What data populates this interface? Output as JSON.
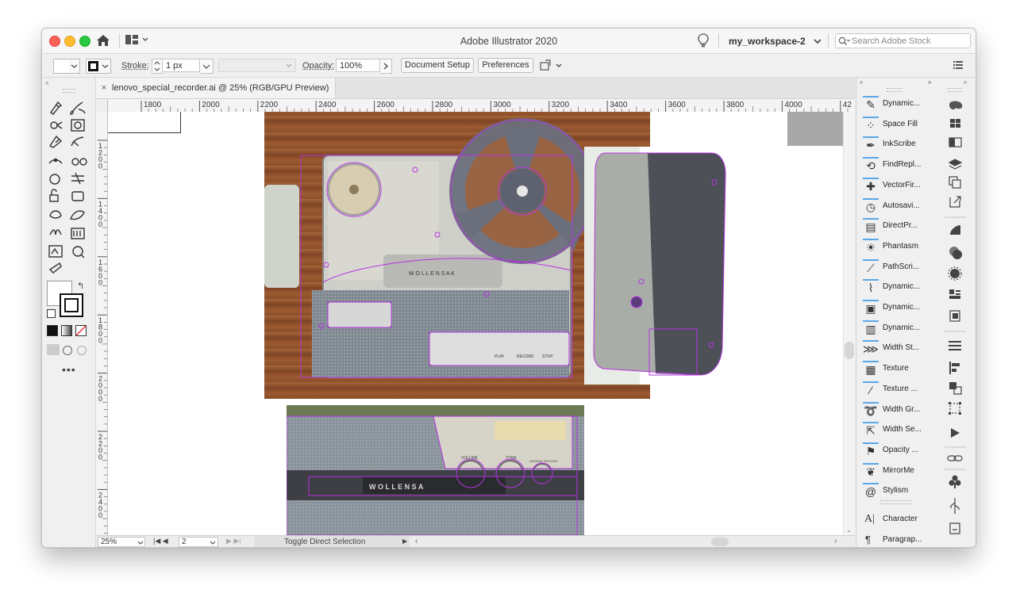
{
  "app": {
    "title": "Adobe Illustrator 2020",
    "workspace": "my_workspace-2",
    "search_placeholder": "Search Adobe Stock"
  },
  "control_bar": {
    "stroke_label": "Stroke:",
    "stroke_value": "1 px",
    "opacity_label": "Opacity:",
    "opacity_value": "100%",
    "document_setup": "Document Setup",
    "preferences": "Preferences"
  },
  "document": {
    "tab_title": "lenovo_special_recorder.ai @ 25% (RGB/GPU Preview)",
    "close_glyph": "×",
    "h_ruler": [
      "1800",
      "2000",
      "2200",
      "2400",
      "2600",
      "2800",
      "3000",
      "3200",
      "3400",
      "3600",
      "3800",
      "4000",
      "42"
    ],
    "v_ruler": [
      "1200",
      "1400",
      "1600",
      "1800",
      "2000",
      "2200",
      "2400"
    ],
    "badge_nameplate": "W O L L E N S A K",
    "badge_front": "W O L L E N S A",
    "knob_labels": [
      "VOLUME",
      "TONE",
      "NORMAL  RECORD"
    ],
    "key_labels": [
      "PLAY",
      "RECORD",
      "STOP"
    ]
  },
  "status_bar": {
    "zoom": "25%",
    "artboard": "2",
    "tool_info": "Toggle Direct Selection"
  },
  "plugin_panel": {
    "items": [
      {
        "label": "Dynamic...",
        "icon": "pen-brush-icon"
      },
      {
        "label": "Space Fill",
        "icon": "dots-fill-icon"
      },
      {
        "label": "InkScribe",
        "icon": "ink-pen-icon"
      },
      {
        "label": "FindRepl...",
        "icon": "find-replace-icon"
      },
      {
        "label": "VectorFir...",
        "icon": "plus-icon"
      },
      {
        "label": "Autosavi...",
        "icon": "clock-icon"
      },
      {
        "label": "DirectPr...",
        "icon": "direct-print-icon"
      },
      {
        "label": "Phantasm",
        "icon": "sun-icon"
      },
      {
        "label": "PathScri...",
        "icon": "path-script-icon"
      },
      {
        "label": "Dynamic...",
        "icon": "dynamic-sketch-icon"
      },
      {
        "label": "Dynamic...",
        "icon": "dynamic-image-icon"
      },
      {
        "label": "Dynamic...",
        "icon": "dynamic-frame-icon"
      },
      {
        "label": "Width St...",
        "icon": "width-stroke-icon"
      },
      {
        "label": "Texture",
        "icon": "texture-icon"
      },
      {
        "label": "Texture ...",
        "icon": "texture-brush-icon"
      },
      {
        "label": "Width Gr...",
        "icon": "width-gradient-icon"
      },
      {
        "label": "Width Se...",
        "icon": "width-select-icon"
      },
      {
        "label": "Opacity ...",
        "icon": "opacity-brush-icon"
      },
      {
        "label": "MirrorMe",
        "icon": "mirror-butterfly-icon"
      },
      {
        "label": "Stylism",
        "icon": "spiral-icon"
      }
    ],
    "character": "Character",
    "paragraph": "Paragrap..."
  },
  "colors": {
    "selection": "#b433e0",
    "chrome": "#f0f0f0"
  }
}
